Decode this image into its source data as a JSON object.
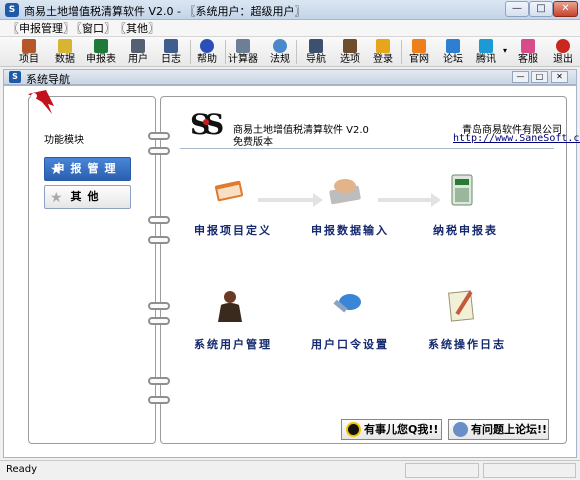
{
  "window": {
    "title": "商易土地增值税清算软件 V2.0 - 〖系统用户：超级用户〗",
    "app_icon_text": "S"
  },
  "menubar": {
    "items": [
      "〖申报管理〗",
      "〖窗口〗",
      "〖其他〗"
    ]
  },
  "toolbar": {
    "items": [
      {
        "label": "项目",
        "icon": "project-icon",
        "color": "#b5562b"
      },
      {
        "label": "数据",
        "icon": "data-icon",
        "color": "#d7b432"
      },
      {
        "label": "申报表",
        "icon": "excel-icon",
        "color": "#1f7a3a"
      },
      {
        "label": "用户",
        "icon": "user-icon",
        "color": "#556072"
      },
      {
        "label": "日志",
        "icon": "log-icon",
        "color": "#3e5f8e"
      },
      {
        "label": "帮助",
        "icon": "help-icon",
        "color": "#2a4fb8"
      },
      {
        "label": "计算器",
        "icon": "calculator-icon",
        "color": "#6d7f96"
      },
      {
        "label": "法规",
        "icon": "search-icon",
        "color": "#4b88c9"
      },
      {
        "label": "导航",
        "icon": "navigation-icon",
        "color": "#3e5070"
      },
      {
        "label": "选项",
        "icon": "options-icon",
        "color": "#6e4d2c"
      },
      {
        "label": "登录",
        "icon": "login-icon",
        "color": "#e5a61a"
      },
      {
        "label": "官网",
        "icon": "rss-icon",
        "color": "#ef7f1a"
      },
      {
        "label": "论坛",
        "icon": "forum-icon",
        "color": "#2e7fd1"
      },
      {
        "label": "腾讯",
        "icon": "qq-icon",
        "color": "#1c9ad6"
      },
      {
        "label": "客服",
        "icon": "service-icon",
        "color": "#d84a8a"
      },
      {
        "label": "退出",
        "icon": "exit-icon",
        "color": "#c8281e"
      }
    ]
  },
  "mdi": {
    "title": "系统导航"
  },
  "left_panel": {
    "section_label": "功能模块",
    "buttons": [
      "申报管理",
      "其他"
    ]
  },
  "header": {
    "company_product": "商易土地增值税清算软件 V2.0",
    "edition": "免费版本",
    "company": "青岛商易软件有限公司",
    "website": "http://www.SaneSoft.cn"
  },
  "functions": {
    "row1": [
      "申报项目定义",
      "申报数据输入",
      "纳税申报表"
    ],
    "row2": [
      "系统用户管理",
      "用户口令设置",
      "系统操作日志"
    ]
  },
  "bottom": {
    "qq_button": "有事儿您Q我!!",
    "forum_button": "有问题上论坛!!"
  },
  "status": {
    "text": "Ready"
  },
  "colors": {
    "accent": "#2a5fb0",
    "label": "#14286e"
  }
}
